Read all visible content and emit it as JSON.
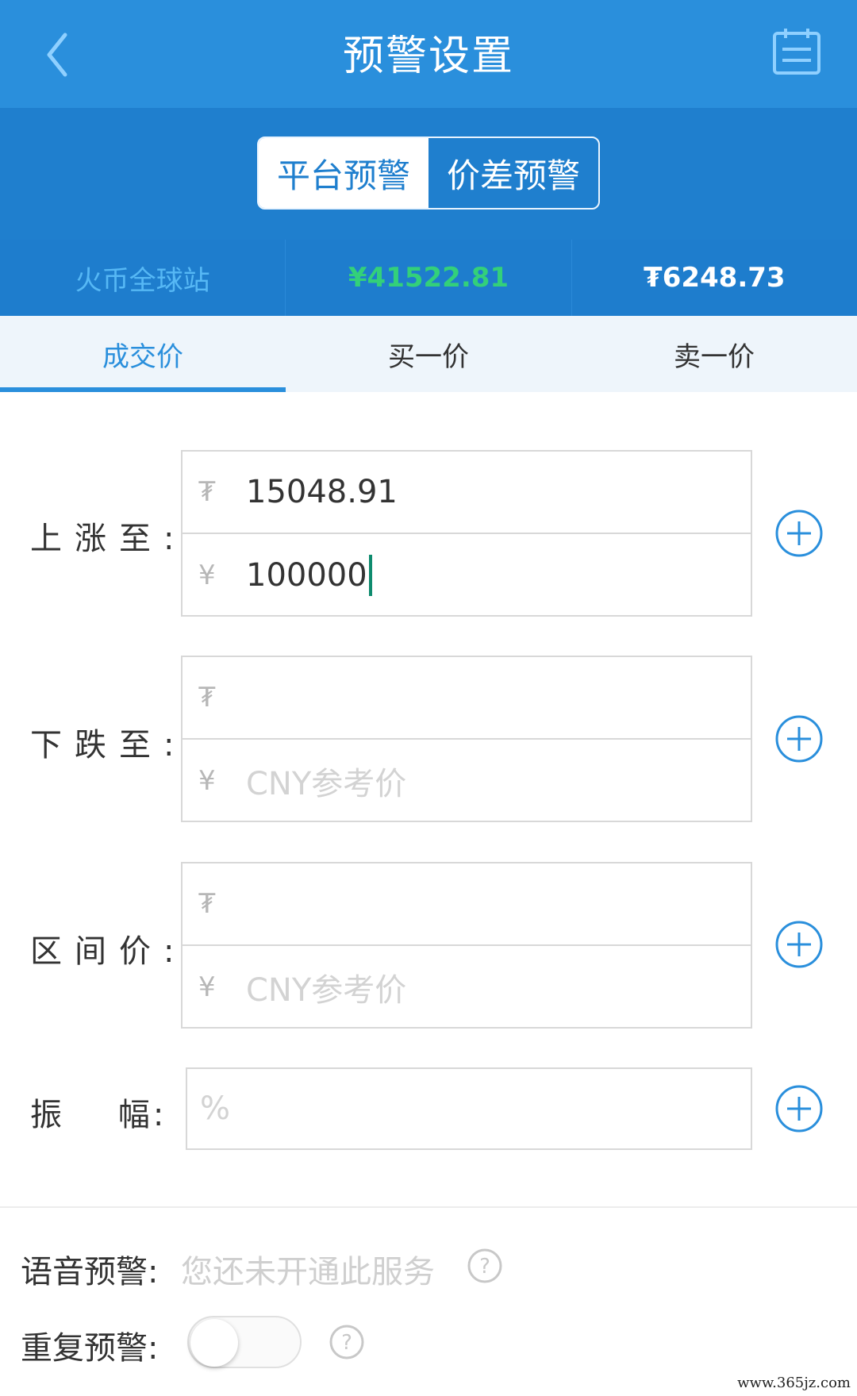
{
  "header": {
    "title": "预警设置"
  },
  "segments": {
    "platform": "平台预警",
    "spread": "价差预警"
  },
  "price_strip": {
    "exchange": "火币全球站",
    "cny_price": "¥41522.81",
    "usdt_price": "₮6248.73"
  },
  "tabs": [
    "成交价",
    "买一价",
    "卖一价"
  ],
  "form": {
    "rise": {
      "label": "上涨至:",
      "usdt_symbol": "₮",
      "usdt_value": "15048.91",
      "cny_symbol": "¥",
      "cny_value": "100000"
    },
    "fall": {
      "label": "下跌至:",
      "usdt_symbol": "₮",
      "cny_symbol": "¥",
      "cny_placeholder": "CNY参考价"
    },
    "range": {
      "label": "区间价:",
      "usdt_symbol": "₮",
      "cny_symbol": "¥",
      "cny_placeholder": "CNY参考价"
    },
    "amplitude": {
      "label": "振    幅:",
      "placeholder": "%"
    }
  },
  "options": {
    "voice": {
      "label": "语音预警:",
      "text": "您还未开通此服务"
    },
    "repeat": {
      "label": "重复预警:"
    }
  },
  "watermark": "www.365jz.com",
  "colors": {
    "primary": "#2a8fdc",
    "header_dark": "#1f7fce",
    "green": "#33d07a"
  }
}
